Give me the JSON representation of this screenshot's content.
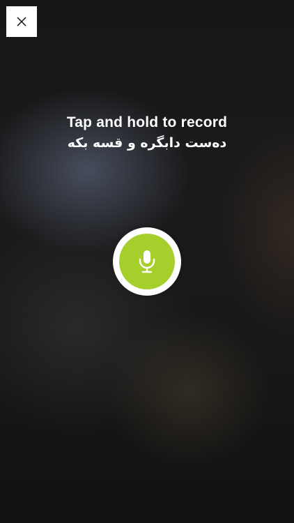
{
  "close_button": {
    "icon": "close-icon",
    "color": "#ffffff"
  },
  "prompt": {
    "english": "Tap and hold to record",
    "kurdish": "دەست دابگرە و قسە بکە"
  },
  "record_button": {
    "icon": "microphone-icon",
    "color": "#a6cf2b"
  }
}
